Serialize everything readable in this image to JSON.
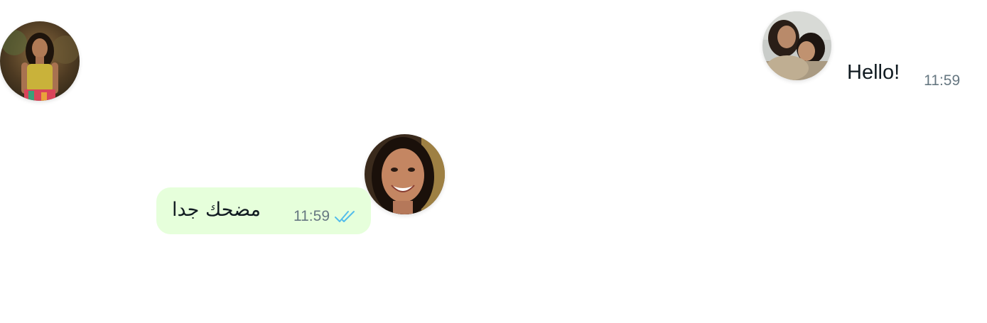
{
  "colors": {
    "outgoing_bubble": "#e6ffdb",
    "message_text": "#111b21",
    "timestamp": "#667781",
    "read_ticks": "#53bdeb"
  },
  "messages": [
    {
      "direction": "incoming",
      "text": "Hello!",
      "time": "11:59"
    },
    {
      "direction": "outgoing",
      "text": "مضحك جدا",
      "time": "11:59",
      "status_icon": "double-check-read-icon"
    }
  ],
  "avatars": [
    {
      "icon": "user-avatar-icon"
    },
    {
      "icon": "user-avatar-icon"
    },
    {
      "icon": "user-avatar-icon"
    }
  ]
}
